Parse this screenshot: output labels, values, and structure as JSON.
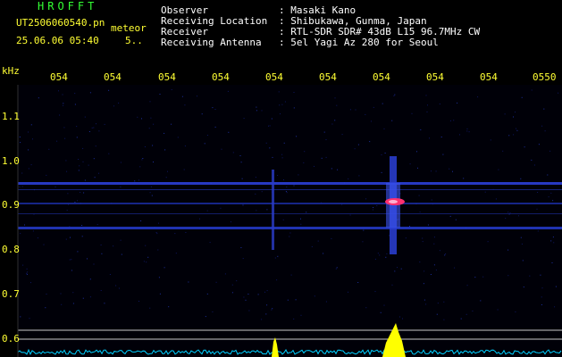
{
  "app": {
    "title": "HROFFT",
    "filename": "UT2506060540.pn",
    "mode": "meteor",
    "datetime": "25.06.06 05:40",
    "counter": "5.."
  },
  "station": {
    "labels": [
      "Observer",
      "Receiving Location",
      "Receiver",
      "Receiving Antenna"
    ],
    "values": [
      ": Masaki Kano",
      ": Shibukawa, Gunma, Japan",
      ": RTL-SDR SDR# 43dB L15 96.7MHz CW",
      ": 5el Yagi Az 280 for Seoul"
    ]
  },
  "axes": {
    "y_unit": "kHz",
    "y_ticks": [
      "1.1",
      "1.0",
      "0.9",
      "0.8",
      "0.7",
      "0.6"
    ],
    "x_ticks": [
      "054",
      "054",
      "054",
      "054",
      "054",
      "054",
      "054",
      "054",
      "054",
      "0550"
    ]
  },
  "colors": {
    "background": "#000000",
    "axis_text": "#ffff33",
    "title_text": "#33ff33",
    "noise_band": "#2b3fd6",
    "echo_core": "#ff3070",
    "spectrum": "#ffff00",
    "spectrum_base": "#00d0ff"
  }
}
